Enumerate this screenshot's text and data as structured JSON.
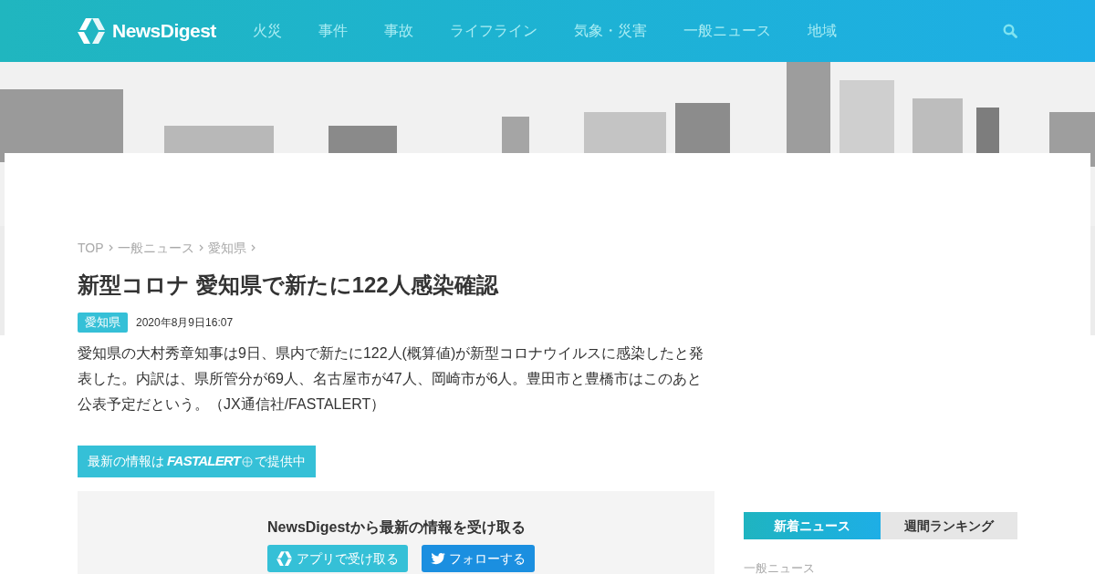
{
  "header": {
    "logo": "NewsDigest",
    "nav": [
      {
        "label": "火災"
      },
      {
        "label": "事件"
      },
      {
        "label": "事故"
      },
      {
        "label": "ライフライン"
      },
      {
        "label": "気象・災害"
      },
      {
        "label": "一般ニュース"
      },
      {
        "label": "地域"
      }
    ]
  },
  "breadcrumb": [
    "TOP",
    "一般ニュース",
    "愛知県"
  ],
  "article": {
    "title": "新型コロナ 愛知県で新たに122人感染確認",
    "tag": "愛知県",
    "date": "2020年8月9日16:07",
    "body": "愛知県の大村秀章知事は9日、県内で新たに122人(概算値)が新型コロナウイルスに感染したと発表した。内訳は、県所管分が69人、名古屋市が47人、岡崎市が6人。豊田市と豊橋市はこのあと公表予定だという。（JX通信社/FASTALERT）"
  },
  "source_button": {
    "prefix": "最新の情報は",
    "brand": "FASTALERT",
    "suffix": "で提供中"
  },
  "subscribe": {
    "title": "NewsDigestから最新の情報を受け取る",
    "buttons": [
      {
        "kind": "app",
        "label": "アプリで受け取る"
      },
      {
        "kind": "twitter",
        "label": "フォローする"
      }
    ]
  },
  "sidebar": {
    "tabs": [
      {
        "label": "新着ニュース",
        "selected": true
      },
      {
        "label": "週間ランキング",
        "selected": false
      }
    ],
    "category": "一般ニュース"
  }
}
